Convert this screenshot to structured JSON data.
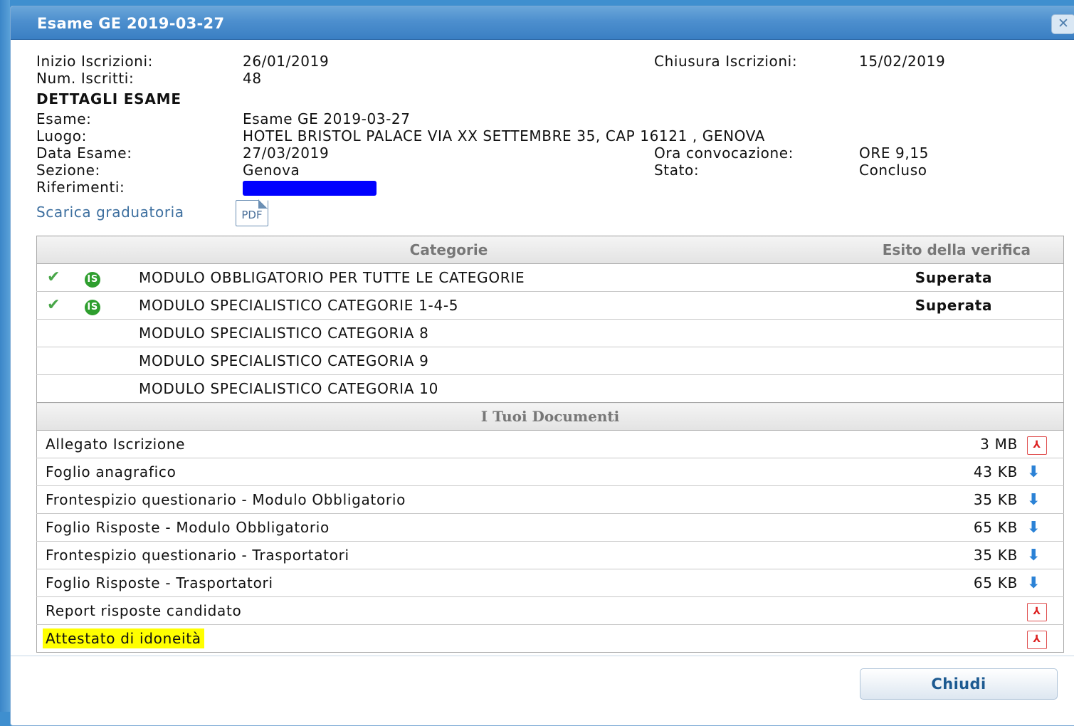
{
  "window": {
    "title": "Esame GE 2019-03-27",
    "close_icon": "close-icon"
  },
  "info": {
    "inizio_label": "Inizio Iscrizioni:",
    "inizio_value": "26/01/2019",
    "chiusura_label": "Chiusura Iscrizioni:",
    "chiusura_value": "15/02/2019",
    "iscritti_label": "Num. Iscritti:",
    "iscritti_value": "48",
    "section_title": "DETTAGLI ESAME",
    "esame_label": "Esame:",
    "esame_value": "Esame GE 2019-03-27",
    "luogo_label": "Luogo:",
    "luogo_value": "HOTEL BRISTOL PALACE VIA XX SETTEMBRE 35, CAP 16121 , GENOVA",
    "data_label": "Data Esame:",
    "data_value": "27/03/2019",
    "ora_label": "Ora convocazione:",
    "ora_value": "ORE 9,15",
    "sezione_label": "Sezione:",
    "sezione_value": "Genova",
    "stato_label": "Stato:",
    "stato_value": "Concluso",
    "riferimenti_label": "Riferimenti:",
    "download_link": "Scarica graduatoria",
    "pdf_icon_text": "PDF"
  },
  "categories": {
    "header_categorie": "Categorie",
    "header_esito": "Esito della verifica",
    "badge_text": "IS",
    "rows": [
      {
        "name": "MODULO OBBLIGATORIO PER TUTTE LE CATEGORIE",
        "esito": "Superata",
        "passed": true
      },
      {
        "name": "MODULO SPECIALISTICO CATEGORIE 1-4-5",
        "esito": "Superata",
        "passed": true
      },
      {
        "name": "MODULO SPECIALISTICO CATEGORIA 8",
        "esito": "",
        "passed": false
      },
      {
        "name": "MODULO SPECIALISTICO CATEGORIA 9",
        "esito": "",
        "passed": false
      },
      {
        "name": "MODULO SPECIALISTICO CATEGORIA 10",
        "esito": "",
        "passed": false
      }
    ]
  },
  "documents": {
    "header": "I Tuoi Documenti",
    "pdf_glyph": "⅄",
    "download_glyph": "⬇",
    "rows": [
      {
        "name": "Allegato Iscrizione",
        "size": "3 MB",
        "icon": "pdf-icon"
      },
      {
        "name": "Foglio anagrafico",
        "size": "43 KB",
        "icon": "download-arrow-icon"
      },
      {
        "name": "Frontespizio questionario - Modulo Obbligatorio",
        "size": "35 KB",
        "icon": "download-arrow-icon"
      },
      {
        "name": "Foglio Risposte - Modulo Obbligatorio",
        "size": "65 KB",
        "icon": "download-arrow-icon"
      },
      {
        "name": "Frontespizio questionario - Trasportatori",
        "size": "35 KB",
        "icon": "download-arrow-icon"
      },
      {
        "name": "Foglio Risposte - Trasportatori",
        "size": "65 KB",
        "icon": "download-arrow-icon"
      },
      {
        "name": "Report risposte candidato",
        "size": "",
        "icon": "pdf-icon"
      },
      {
        "name": "Attestato di idoneità",
        "size": "",
        "icon": "pdf-icon",
        "highlighted": true
      }
    ]
  },
  "footer": {
    "close_button": "Chiudi"
  },
  "colors": {
    "title_bar": "#4d8fce",
    "passed": "#1c8a1c",
    "highlight": "#ffff00",
    "redaction": "#0000ff"
  }
}
